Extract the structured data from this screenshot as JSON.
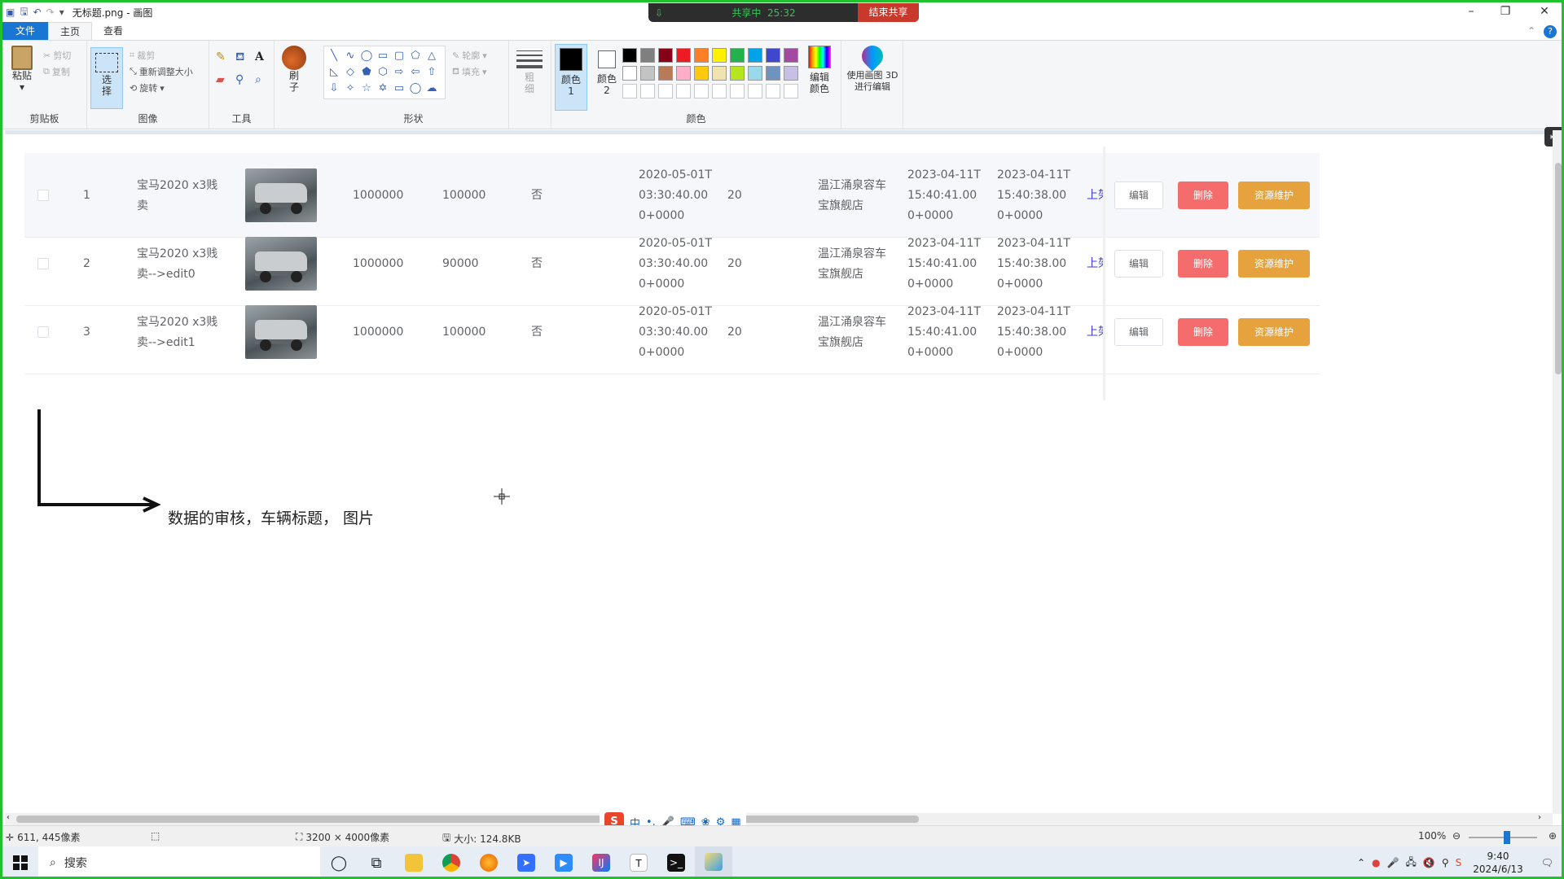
{
  "window": {
    "title": "无标题.png - 画图",
    "share_status": "共享中",
    "share_timer": "25:32",
    "end_share": "结束共享"
  },
  "tabs": [
    "文件",
    "主页",
    "查看"
  ],
  "ribbon": {
    "clipboard": {
      "paste": "粘贴",
      "cut": "剪切",
      "copy": "复制",
      "label": "剪贴板"
    },
    "image": {
      "select": "选择",
      "crop": "裁剪",
      "resize": "重新调整大小",
      "rotate": "旋转",
      "label": "图像"
    },
    "tools": {
      "label": "工具"
    },
    "brush": {
      "label": "刷子"
    },
    "shapes": {
      "outline": "轮廓",
      "fill": "填充",
      "label": "形状"
    },
    "size": {
      "label": "粗细"
    },
    "colors": {
      "color1": "颜色 1",
      "color2": "颜色 2",
      "edit_colors": "编辑颜色",
      "label": "颜色",
      "palette_row1": [
        "#000000",
        "#7f7f7f",
        "#880015",
        "#ed1c24",
        "#ff7f27",
        "#fff200",
        "#22b14c",
        "#00a2e8",
        "#3f48cc",
        "#a349a4"
      ],
      "palette_row2": [
        "#ffffff",
        "#c3c3c3",
        "#b97a57",
        "#ffaec9",
        "#ffc90e",
        "#efe4b0",
        "#b5e61d",
        "#99d9ea",
        "#7092be",
        "#c8bfe7"
      ]
    },
    "paint3d": "使用画图 3D 进行编辑"
  },
  "table": {
    "rows": [
      {
        "index": "1",
        "title": "宝马2020 x3贱卖",
        "price": "1000000",
        "mileage": "100000",
        "flag": "否",
        "date": "2020-05-01T03:30:40.000+0000",
        "count": "20",
        "shop": "温江涌泉容车宝旗舰店",
        "created": "2023-04-11T15:40:41.000+0000",
        "updated": "2023-04-11T15:40:38.000+0000",
        "link": "上架"
      },
      {
        "index": "2",
        "title": "宝马2020 x3贱卖-->edit0",
        "price": "1000000",
        "mileage": "90000",
        "flag": "否",
        "date": "2020-05-01T03:30:40.000+0000",
        "count": "20",
        "shop": "温江涌泉容车宝旗舰店",
        "created": "2023-04-11T15:40:41.000+0000",
        "updated": "2023-04-11T15:40:38.000+0000",
        "link": "上架"
      },
      {
        "index": "3",
        "title": "宝马2020 x3贱卖-->edit1",
        "price": "1000000",
        "mileage": "100000",
        "flag": "否",
        "date": "2020-05-01T03:30:40.000+0000",
        "count": "20",
        "shop": "温江涌泉容车宝旗舰店",
        "created": "2023-04-11T15:40:41.000+0000",
        "updated": "2023-04-11T15:40:38.000+0000",
        "link": "上架"
      }
    ],
    "btn_edit": "编辑",
    "btn_delete": "删除",
    "btn_resource": "资源维护"
  },
  "annotation": "数据的审核，车辆标题，  图片",
  "statusbar": {
    "cursor_pos": "611, 445像素",
    "image_size": "3200 × 4000像素",
    "file_size": "大小: 124.8KB",
    "zoom": "100%"
  },
  "ime": {
    "mode": "中",
    "punct": "•,"
  },
  "taskbar": {
    "search_placeholder": "搜索",
    "time": "9:40",
    "date": "2024/6/13"
  }
}
